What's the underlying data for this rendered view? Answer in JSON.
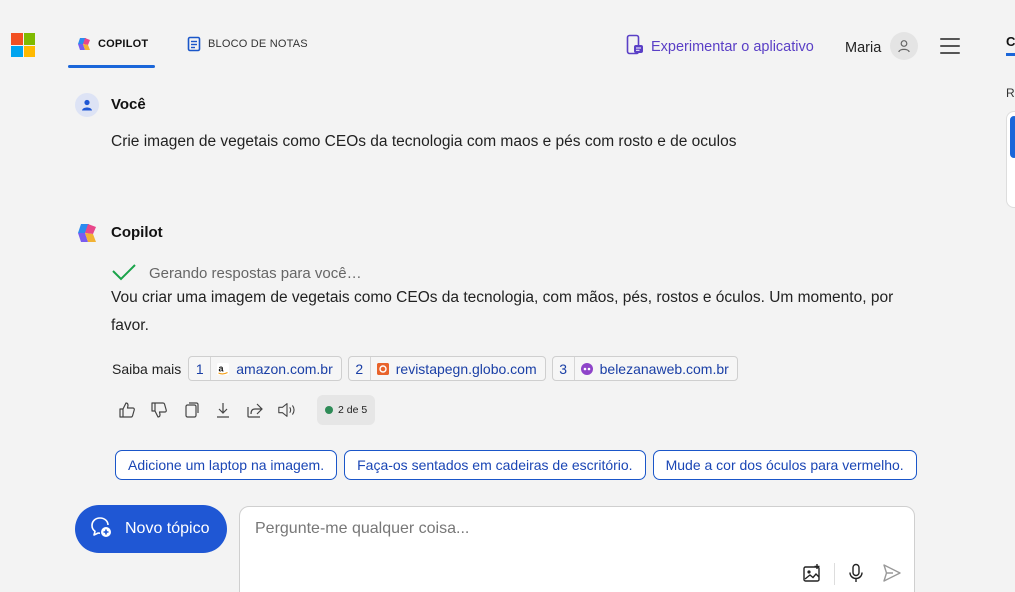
{
  "header": {
    "brand_colors": [
      "#f25022",
      "#7fba00",
      "#00a4ef",
      "#ffb900"
    ],
    "tabs": [
      {
        "label": "COPILOT",
        "icon": "copilot-icon",
        "active": true
      },
      {
        "label": "BLOCO DE NOTAS",
        "icon": "notebook-icon",
        "active": false
      }
    ],
    "try_app_label": "Experimentar o aplicativo",
    "user_name": "Maria"
  },
  "side_panel": {
    "tab_label": "C",
    "sub_label": "R"
  },
  "conversation": {
    "user_message": {
      "author": "Você",
      "text": "Crie imagen de vegetais como CEOs da tecnologia com maos e pés com rosto e de oculos"
    },
    "copilot_message": {
      "author": "Copilot",
      "status": "Gerando respostas para você…",
      "text": "Vou criar uma imagem de vegetais como CEOs da tecnologia, com mãos, pés, rostos e óculos. Um momento, por favor."
    },
    "learn_more": {
      "label": "Saiba mais",
      "sources": [
        {
          "num": "1",
          "domain": "amazon.com.br",
          "favicon": "amazon-favicon"
        },
        {
          "num": "2",
          "domain": "revistapegn.globo.com",
          "favicon": "pegn-favicon"
        },
        {
          "num": "3",
          "domain": "belezanaweb.com.br",
          "favicon": "belezanaweb-favicon"
        }
      ]
    },
    "page_indicator": "2 de 5"
  },
  "suggestions": [
    "Adicione um laptop na imagem.",
    "Faça-os sentados em cadeiras de escritório.",
    "Mude a cor dos óculos para vermelho."
  ],
  "composer": {
    "new_topic_label": "Novo tópico",
    "placeholder": "Pergunte-me qualquer coisa..."
  },
  "colors": {
    "accent": "#1f57d4",
    "try_app": "#5a3fc6",
    "status_check": "#1aa34a"
  }
}
